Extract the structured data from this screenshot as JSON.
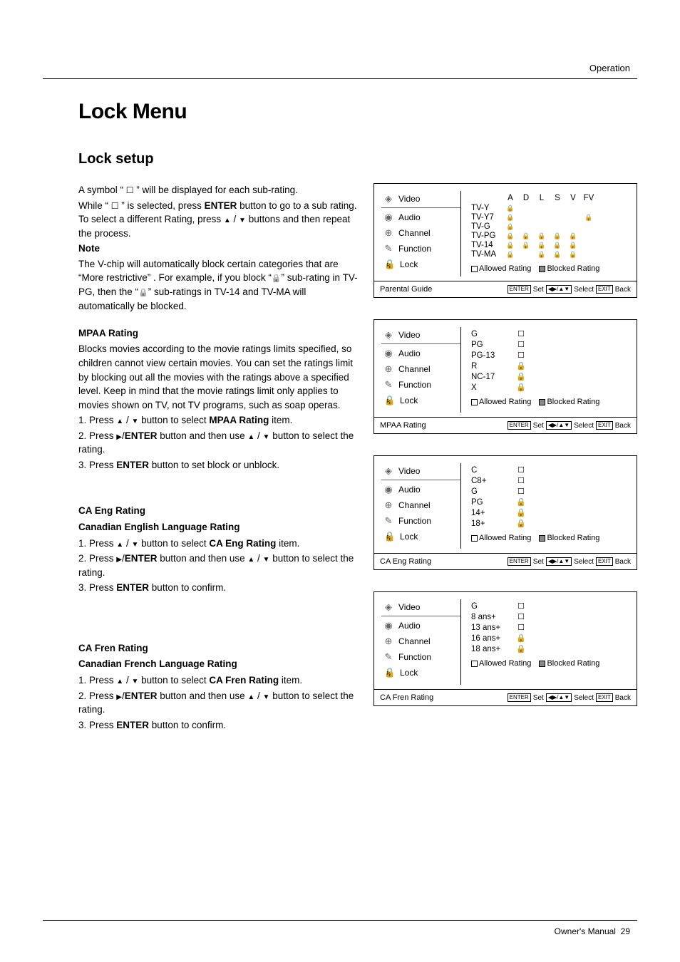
{
  "header": {
    "section": "Operation"
  },
  "title": "Lock Menu",
  "subtitle": "Lock setup",
  "footer": {
    "label": "Owner's Manual",
    "page": "29"
  },
  "intro": {
    "p1a": "A symbol “ ",
    "p1b": " ” will be displayed for each sub-rating.",
    "p2a": "While “ ",
    "p2b": " ” is selected, press ",
    "p2c": "ENTER",
    "p2d": " button to go to a sub rating. To select a different Rating, press ",
    "p2e": " / ",
    "p2f": " buttons and then repeat the process.",
    "noteLabel": "Note",
    "note1": "The V-chip will automatically block certain categories that are “More restrictive” . For example, if you block “",
    "note2": "” sub-rating in TV-PG, then the “",
    "note3": "” sub-ratings in TV-14 and TV-MA will automatically be blocked."
  },
  "mpaa": {
    "head": "MPAA Rating",
    "body": "Blocks movies according to the movie ratings limits specified, so children cannot view certain movies. You can set the ratings limit by blocking out all the movies with the ratings above a specified level. Keep in mind that the movie ratings limit only applies to movies shown on TV, not TV programs, such as soap operas.",
    "s1a": "1. Press ",
    "s1b": " / ",
    "s1c": " button to select ",
    "s1d": "MPAA Rating",
    "s1e": " item.",
    "s2a": "2. Press ",
    "s2b": "/",
    "s2c": "ENTER",
    "s2d": " button and then use ",
    "s2e": " / ",
    "s2f": " button to select the rating.",
    "s3a": "3. Press ",
    "s3b": "ENTER",
    "s3c": " button to set block or unblock."
  },
  "caeng": {
    "head": "CA Eng Rating",
    "sub": "Canadian English Language Rating",
    "s1a": "1. Press ",
    "s1b": " / ",
    "s1c": " button to select ",
    "s1d": "CA Eng Rating",
    "s1e": " item.",
    "s2a": "2. Press ",
    "s2b": "/",
    "s2c": "ENTER",
    "s2d": " button and then use ",
    "s2e": " / ",
    "s2f": " button to select the rating.",
    "s3a": "3. Press ",
    "s3b": "ENTER",
    "s3c": " button to confirm."
  },
  "cafren": {
    "head": "CA Fren Rating",
    "sub": "Canadian French Language Rating",
    "s1a": "1. Press ",
    "s1b": " / ",
    "s1c": " button to select ",
    "s1d": "CA Fren Rating",
    "s1e": " item.",
    "s2a": "2. Press ",
    "s2b": "/",
    "s2c": "ENTER",
    "s2d": " button and then use ",
    "s2e": " / ",
    "s2f": " button to select the rating.",
    "s3a": "3. Press ",
    "s3b": "ENTER",
    "s3c": " button to confirm."
  },
  "osd_menu_labels": {
    "video": "Video",
    "audio": "Audio",
    "channel": "Channel",
    "function": "Function",
    "lock": "Lock"
  },
  "parental": {
    "title": "Parental Guide",
    "cols": [
      "A",
      "D",
      "L",
      "S",
      "V",
      "FV"
    ],
    "rows": [
      {
        "name": "TV-Y",
        "cells": [
          "lock",
          "",
          "",
          "",
          "",
          ""
        ]
      },
      {
        "name": "TV-Y7",
        "cells": [
          "lock",
          "",
          "",
          "",
          "",
          "lock"
        ]
      },
      {
        "name": "TV-G",
        "cells": [
          "lock",
          "",
          "",
          "",
          "",
          ""
        ]
      },
      {
        "name": "TV-PG",
        "cells": [
          "lock",
          "lock",
          "lock",
          "lock",
          "lock",
          ""
        ]
      },
      {
        "name": "TV-14",
        "cells": [
          "lock",
          "lock",
          "lock",
          "lock",
          "lock",
          ""
        ]
      },
      {
        "name": "TV-MA",
        "cells": [
          "lock",
          "",
          "lock",
          "lock",
          "lock",
          ""
        ]
      }
    ]
  },
  "mpaa_panel": {
    "title": "MPAA Rating",
    "rows": [
      {
        "name": "G",
        "icon": "empty"
      },
      {
        "name": "PG",
        "icon": "empty"
      },
      {
        "name": "PG-13",
        "icon": "empty"
      },
      {
        "name": "R",
        "icon": "lock"
      },
      {
        "name": "NC-17",
        "icon": "lock"
      },
      {
        "name": "X",
        "icon": "lock"
      }
    ]
  },
  "caeng_panel": {
    "title": "CA Eng Rating",
    "rows": [
      {
        "name": "C",
        "icon": "empty"
      },
      {
        "name": "C8+",
        "icon": "empty"
      },
      {
        "name": "G",
        "icon": "empty"
      },
      {
        "name": "PG",
        "icon": "lock"
      },
      {
        "name": "14+",
        "icon": "lock"
      },
      {
        "name": "18+",
        "icon": "lock"
      }
    ]
  },
  "cafren_panel": {
    "title": "CA Fren Rating",
    "rows": [
      {
        "name": "G",
        "icon": "empty"
      },
      {
        "name": "8 ans+",
        "icon": "empty"
      },
      {
        "name": "13 ans+",
        "icon": "empty"
      },
      {
        "name": "16 ans+",
        "icon": "lock"
      },
      {
        "name": "18 ans+",
        "icon": "lock"
      }
    ]
  },
  "legend": {
    "allowed": "Allowed Rating",
    "blocked": "Blocked Rating"
  },
  "footbtns": {
    "enter": "ENTER",
    "set": "Set",
    "arrows": "◀▶/▲▼",
    "select": "Select",
    "exit": "EXIT",
    "back": "Back"
  }
}
